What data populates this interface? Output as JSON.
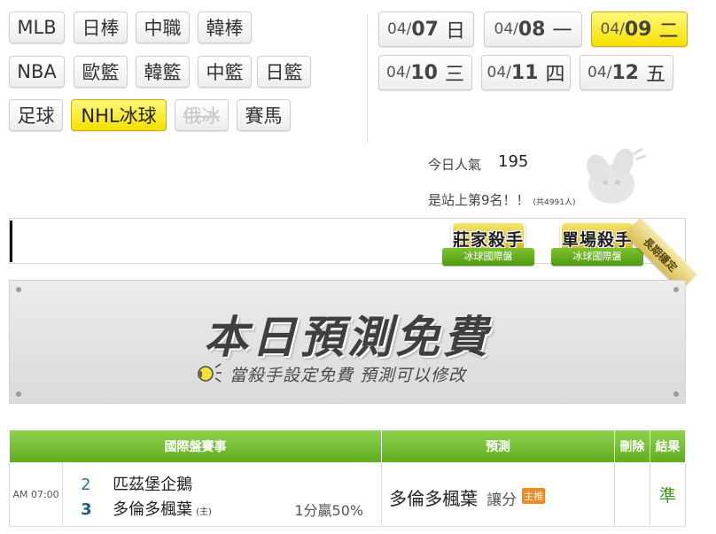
{
  "sports": {
    "row1": [
      "MLB",
      "日棒",
      "中職",
      "韓棒"
    ],
    "row2": [
      "NBA",
      "歐籃",
      "韓籃",
      "中籃",
      "日籃"
    ],
    "row3": [
      "足球",
      "NHL冰球",
      "俄冰",
      "賽馬"
    ]
  },
  "dates": [
    {
      "mm": "04/",
      "dd": "07",
      "dow": "日"
    },
    {
      "mm": "04/",
      "dd": "08",
      "dow": "一"
    },
    {
      "mm": "04/",
      "dd": "09",
      "dow": "二"
    },
    {
      "mm": "04/",
      "dd": "10",
      "dow": "三"
    },
    {
      "mm": "04/",
      "dd": "11",
      "dow": "四"
    },
    {
      "mm": "04/",
      "dd": "12",
      "dow": "五"
    }
  ],
  "popularity": {
    "label": "今日人氣",
    "value": "195",
    "rank_text": "是站上第9名！！",
    "total": "(共4991人)"
  },
  "badges": [
    {
      "title": "莊家殺手",
      "subtitle": "冰球國際盤"
    },
    {
      "title": "單場殺手",
      "subtitle": "冰球國際盤"
    }
  ],
  "corner_ribbon": "長期穩定",
  "banner": {
    "headline": "本日預測免費",
    "subline": "當殺手設定免費  預測可以修改"
  },
  "table": {
    "headers": {
      "game": "國際盤賽事",
      "prediction": "預測",
      "delete": "刪除",
      "result": "結果"
    },
    "rows": [
      {
        "time": "AM 07:00",
        "away_num": "2",
        "away_team": "匹茲堡企鵝",
        "home_num": "3",
        "home_team": "多倫多楓葉",
        "home_marker": "(主)",
        "handicap": "1分贏50%",
        "pick_team": "多倫多楓葉",
        "pick_type": "讓分",
        "pick_tag": "主推",
        "result": "準"
      }
    ]
  },
  "colors": {
    "active_yellow": "#f5e100",
    "table_header_green": "#5fae20",
    "result_green": "#3a9a15",
    "team_number_blue": "#2d6ea8"
  }
}
